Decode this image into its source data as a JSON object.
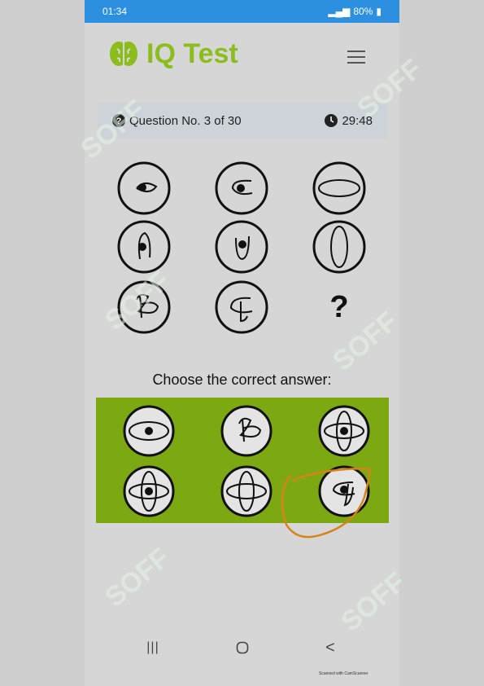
{
  "status_bar": {
    "time": "01:34",
    "battery": "80%"
  },
  "app": {
    "title": "IQ Test",
    "brand_color": "#8bbd1c",
    "logo_icon": "brain-icon"
  },
  "question": {
    "label": "Question No. 3 of 30",
    "timer": "29:48"
  },
  "puzzle": {
    "missing_symbol": "?"
  },
  "answers": {
    "prompt": "Choose the correct answer:",
    "panel_color": "#7ca812"
  },
  "footer": {
    "scanner_note": "Scanned with CamScanner"
  },
  "watermarks": [
    "SOFF",
    "SOFF",
    "SOFF",
    "SOFF",
    "SOFF",
    "SOFF"
  ],
  "navigation": {
    "recents_glyph": "|||",
    "back_glyph": "<"
  }
}
